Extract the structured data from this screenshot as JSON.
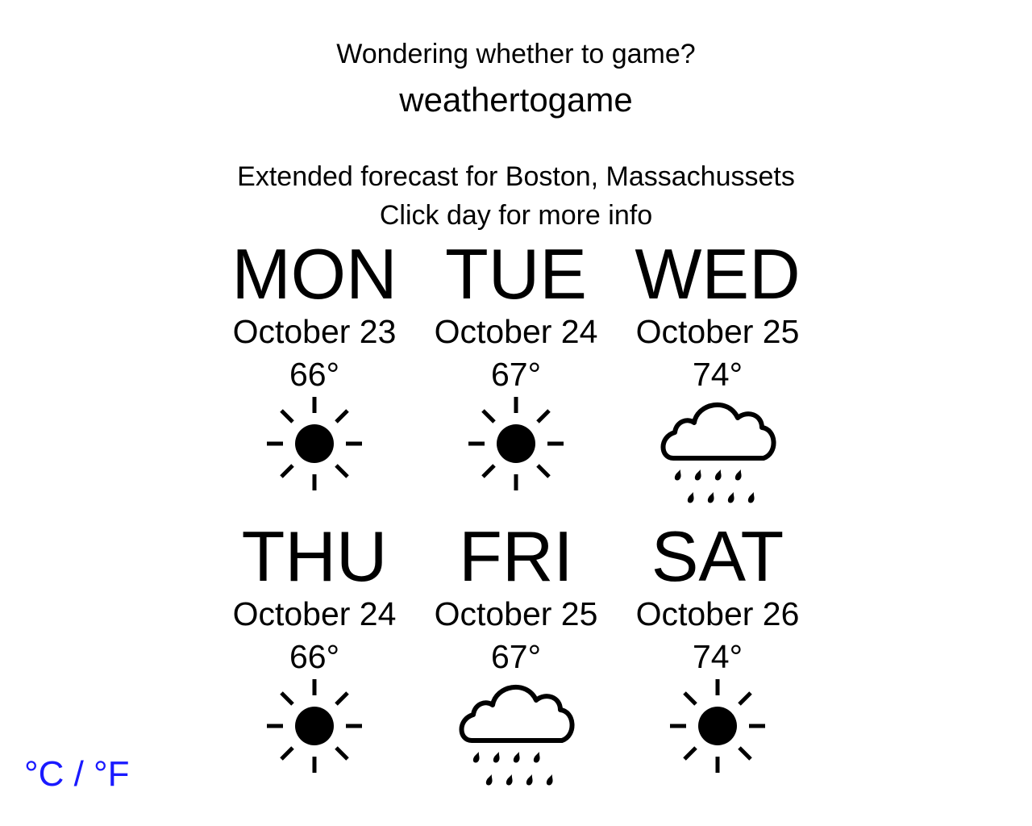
{
  "header": {
    "tagline": "Wondering whether to game?",
    "brand": "weathertogame",
    "forecast_title": "Extended forecast for Boston, Massachussets",
    "hint": "Click day for more info"
  },
  "days": [
    {
      "name": "MON",
      "date": "October 23",
      "temp": "66°",
      "icon": "sun-icon"
    },
    {
      "name": "TUE",
      "date": "October 24",
      "temp": "67°",
      "icon": "sun-icon"
    },
    {
      "name": "WED",
      "date": "October 25",
      "temp": "74°",
      "icon": "rain-cloud-icon"
    },
    {
      "name": "THU",
      "date": "October 24",
      "temp": "66°",
      "icon": "sun-icon"
    },
    {
      "name": "FRI",
      "date": "October 25",
      "temp": "67°",
      "icon": "rain-cloud-icon"
    },
    {
      "name": "SAT",
      "date": "October 26",
      "temp": "74°",
      "icon": "sun-icon"
    }
  ],
  "unit_toggle": "°C / °F",
  "colors": {
    "link": "#1a1aff",
    "text": "#000000",
    "background": "#ffffff"
  }
}
